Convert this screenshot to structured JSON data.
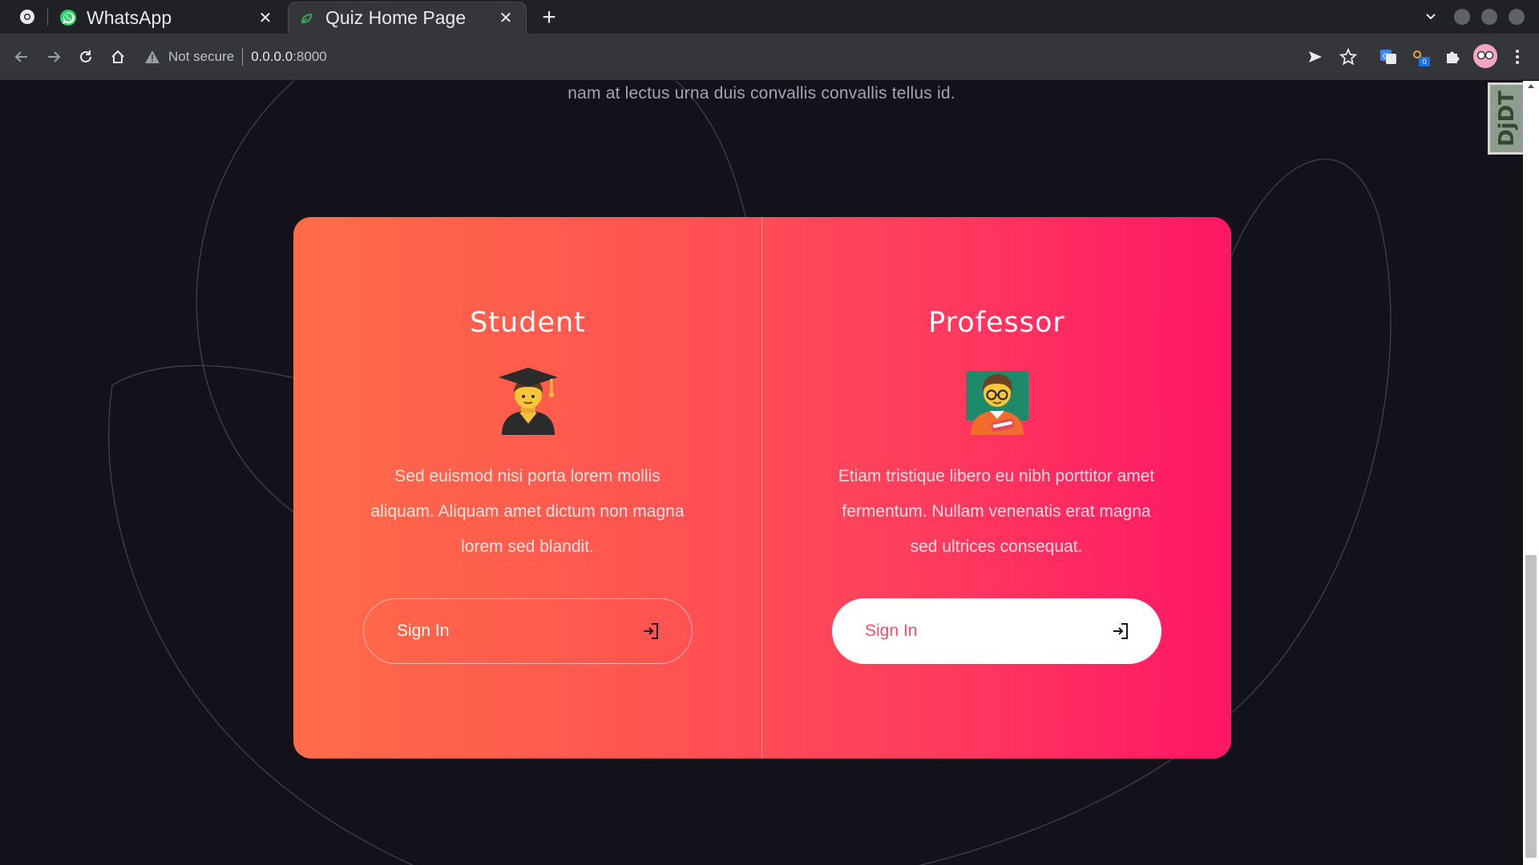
{
  "browser": {
    "tabs": [
      {
        "title": "WhatsApp",
        "active": false,
        "favicon": "whatsapp-icon"
      },
      {
        "title": "Quiz Home Page",
        "active": true,
        "favicon": "leaf-icon"
      }
    ],
    "close_glyph": "✕",
    "new_tab_glyph": "+",
    "address": {
      "security_label": "Not secure",
      "host": "0.0.0.0",
      "port": ":8000"
    },
    "extension_badge": "0"
  },
  "page": {
    "lead_text": "nam at lectus urna duis convallis convallis tellus id.",
    "cards": [
      {
        "title": "Student",
        "emoji": "graduate-emoji",
        "description": "Sed euismod nisi porta lorem mollis aliquam. Aliquam amet dictum non magna lorem sed blandit.",
        "button_label": "Sign In",
        "button_style": "outline"
      },
      {
        "title": "Professor",
        "emoji": "teacher-emoji",
        "description": "Etiam tristique libero eu nibh porttitor amet fermentum. Nullam venenatis erat magna sed ultrices consequat.",
        "button_label": "Sign In",
        "button_style": "solid"
      }
    ]
  },
  "debug_toolbar": {
    "label": "DjDT"
  },
  "colors": {
    "background": "#131119",
    "gradient_start": "#ff6b48",
    "gradient_end": "#ff1665",
    "accent_text": "#ff4a61"
  }
}
